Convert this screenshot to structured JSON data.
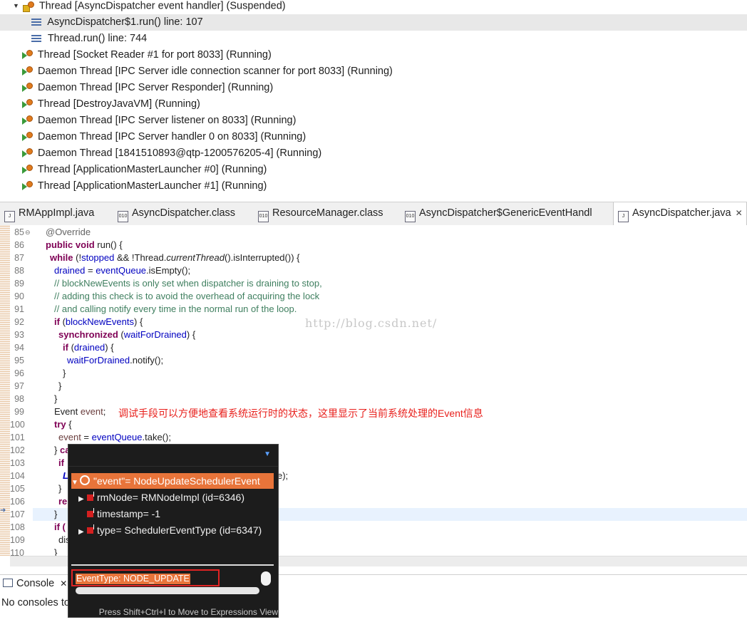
{
  "debug": {
    "threads": [
      {
        "label": "Thread [AsyncDispatcher event handler] (Suspended)",
        "icon": "suspended-thread-icon"
      },
      {
        "label": "AsyncDispatcher$1.run() line: 107",
        "icon": "stack-frame-icon"
      },
      {
        "label": "Thread.run() line: 744",
        "icon": "stack-frame-icon"
      },
      {
        "label": "Thread [Socket Reader #1 for port 8033] (Running)",
        "icon": "running-thread-icon"
      },
      {
        "label": "Daemon Thread [IPC Server idle connection scanner for port 8033] (Running)",
        "icon": "running-thread-icon"
      },
      {
        "label": "Daemon Thread [IPC Server Responder] (Running)",
        "icon": "running-thread-icon"
      },
      {
        "label": "Thread [DestroyJavaVM] (Running)",
        "icon": "running-thread-icon"
      },
      {
        "label": "Daemon Thread [IPC Server listener on 8033] (Running)",
        "icon": "running-thread-icon"
      },
      {
        "label": "Daemon Thread [IPC Server handler 0 on 8033] (Running)",
        "icon": "running-thread-icon"
      },
      {
        "label": "Daemon Thread [1841510893@qtp-1200576205-4] (Running)",
        "icon": "running-thread-icon"
      },
      {
        "label": "Thread [ApplicationMasterLauncher #0] (Running)",
        "icon": "running-thread-icon"
      },
      {
        "label": "Thread [ApplicationMasterLauncher #1] (Running)",
        "icon": "running-thread-icon"
      }
    ]
  },
  "tabs": [
    {
      "label": "RMAppImpl.java",
      "icon": "java-file-icon"
    },
    {
      "label": "AsyncDispatcher.class",
      "icon": "class-file-icon"
    },
    {
      "label": "ResourceManager.class",
      "icon": "class-file-icon"
    },
    {
      "label": "AsyncDispatcher$GenericEventHandl",
      "icon": "class-file-icon"
    },
    {
      "label": "AsyncDispatcher.java",
      "icon": "java-file-icon",
      "active": true
    }
  ],
  "tab_close_glyph": "✕",
  "editor": {
    "line_numbers": [
      "85",
      "86",
      "87",
      "88",
      "89",
      "90",
      "91",
      "92",
      "93",
      "94",
      "95",
      "96",
      "97",
      "98",
      "99",
      "100",
      "101",
      "102",
      "103",
      "104",
      "105",
      "106",
      "107",
      "108",
      "109",
      "110"
    ],
    "current_line": "107",
    "watermark": "http://blog.csdn.net/",
    "annotation": "调试手段可以方便地查看系统运行时的状态，这里显示了当前系统处理的Event信息",
    "code": {
      "l85": "@Override",
      "l86a": "public",
      "l86b": "void",
      "l86c": "run() {",
      "l87a": "while",
      "l87b": "(!",
      "l87c": "stopped",
      "l87d": " && !Thread.",
      "l87e": "currentThread",
      "l87f": "().isInterrupted()) {",
      "l88a": "drained",
      "l88b": " = ",
      "l88c": "eventQueue",
      "l88d": ".isEmpty();",
      "l89": "// blockNewEvents is only set when dispatcher is draining to stop,",
      "l90": "// adding this check is to avoid the overhead of acquiring the lock",
      "l91": "// and calling notify every time in the normal run of the loop.",
      "l92a": "if",
      "l92b": " (",
      "l92c": "blockNewEvents",
      "l92d": ") {",
      "l93a": "synchronized",
      "l93b": " (",
      "l93c": "waitForDrained",
      "l93d": ") {",
      "l94a": "if",
      "l94b": " (",
      "l94c": "drained",
      "l94d": ") {",
      "l95a": "waitForDrained",
      "l95b": ".notify();",
      "l96": "}",
      "l97": "}",
      "l98": "}",
      "l99a": "Event",
      "l99b": "event",
      "l99c": ";",
      "l100a": "try",
      "l100b": " {",
      "l101a": "event",
      "l101b": " = ",
      "l101c": "eventQueue",
      "l101d": ".take();",
      "l102a": "} ",
      "l102b": "ca",
      "l103": "if",
      "l104": "L",
      "l104tail": "e);",
      "l105": "}",
      "l106": "re",
      "l107": "}",
      "l108": "if (",
      "l109": "dis",
      "l110": "}"
    }
  },
  "console": {
    "tab_label": "Console",
    "tab_close": "✕",
    "message": "No consoles to"
  },
  "popup": {
    "root": {
      "name": "\"event\"",
      "value": "= NodeUpdateSchedulerEvent"
    },
    "children": [
      {
        "expandable": true,
        "name": "rmNode",
        "value": "= RMNodeImpl  (id=6346)"
      },
      {
        "expandable": false,
        "name": "timestamp",
        "value": "= -1"
      },
      {
        "expandable": true,
        "name": "type",
        "value": "= SchedulerEventType  (id=6347)"
      }
    ],
    "detail": "EventType: NODE_UPDATE",
    "footer": "Press Shift+Ctrl+I to Move to Expressions View"
  },
  "colors": {
    "keyword": "#7f0055",
    "field": "#0000c0",
    "comment": "#3f7f5f",
    "annotation_note": "#e8201c",
    "popup_selection": "#e8743a",
    "popup_highlight_border": "#e02424"
  }
}
